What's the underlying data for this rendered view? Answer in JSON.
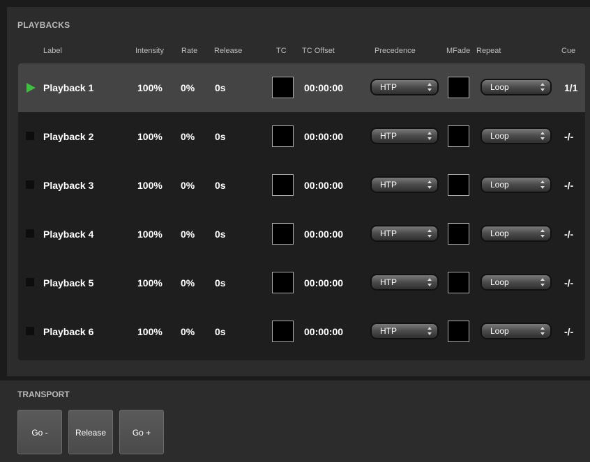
{
  "playbacks": {
    "title": "PLAYBACKS",
    "headers": {
      "label": "Label",
      "intensity": "Intensity",
      "rate": "Rate",
      "release": "Release",
      "tc": "TC",
      "tc_offset": "TC Offset",
      "precedence": "Precedence",
      "mfade": "MFade",
      "repeat": "Repeat",
      "cue": "Cue"
    },
    "rows": [
      {
        "status": "playing",
        "label": "Playback 1",
        "intensity": "100%",
        "rate": "0%",
        "release": "0s",
        "tc_offset": "00:00:00",
        "precedence": "HTP",
        "repeat": "Loop",
        "cue": "1/1"
      },
      {
        "status": "stopped",
        "label": "Playback 2",
        "intensity": "100%",
        "rate": "0%",
        "release": "0s",
        "tc_offset": "00:00:00",
        "precedence": "HTP",
        "repeat": "Loop",
        "cue": "-/-"
      },
      {
        "status": "stopped",
        "label": "Playback 3",
        "intensity": "100%",
        "rate": "0%",
        "release": "0s",
        "tc_offset": "00:00:00",
        "precedence": "HTP",
        "repeat": "Loop",
        "cue": "-/-"
      },
      {
        "status": "stopped",
        "label": "Playback 4",
        "intensity": "100%",
        "rate": "0%",
        "release": "0s",
        "tc_offset": "00:00:00",
        "precedence": "HTP",
        "repeat": "Loop",
        "cue": "-/-"
      },
      {
        "status": "stopped",
        "label": "Playback 5",
        "intensity": "100%",
        "rate": "0%",
        "release": "0s",
        "tc_offset": "00:00:00",
        "precedence": "HTP",
        "repeat": "Loop",
        "cue": "-/-"
      },
      {
        "status": "stopped",
        "label": "Playback 6",
        "intensity": "100%",
        "rate": "0%",
        "release": "0s",
        "tc_offset": "00:00:00",
        "precedence": "HTP",
        "repeat": "Loop",
        "cue": "-/-"
      }
    ]
  },
  "transport": {
    "title": "TRANSPORT",
    "go_minus_label": "Go -",
    "release_label": "Release",
    "go_plus_label": "Go +"
  },
  "colors": {
    "playing_accent": "#3fbf3f",
    "panel_bg": "#2c2c2c",
    "selected_row_bg": "#444444"
  }
}
